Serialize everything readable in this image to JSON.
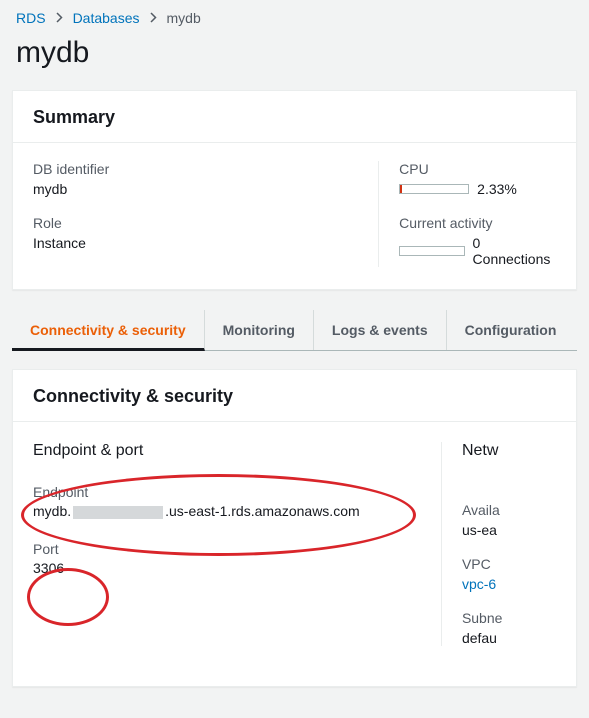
{
  "breadcrumb": {
    "root": "RDS",
    "level1": "Databases",
    "current": "mydb"
  },
  "page_title": "mydb",
  "summary": {
    "heading": "Summary",
    "db_identifier_label": "DB identifier",
    "db_identifier_value": "mydb",
    "role_label": "Role",
    "role_value": "Instance",
    "cpu_label": "CPU",
    "cpu_value": "2.33%",
    "activity_label": "Current activity",
    "activity_value": "0 Connections"
  },
  "tabs": {
    "t0": "Connectivity & security",
    "t1": "Monitoring",
    "t2": "Logs & events",
    "t3": "Configuration"
  },
  "cs": {
    "heading": "Connectivity & security",
    "endpoint_port_heading": "Endpoint & port",
    "endpoint_label": "Endpoint",
    "endpoint_prefix": "mydb.",
    "endpoint_suffix": ".us-east-1.rds.amazonaws.com",
    "port_label": "Port",
    "port_value": "3306",
    "network_heading": "Netw",
    "avail_label": "Availa",
    "avail_value": "us-ea",
    "vpc_label": "VPC",
    "vpc_value": "vpc-6",
    "subnet_label": "Subne",
    "subnet_value": "defau"
  }
}
